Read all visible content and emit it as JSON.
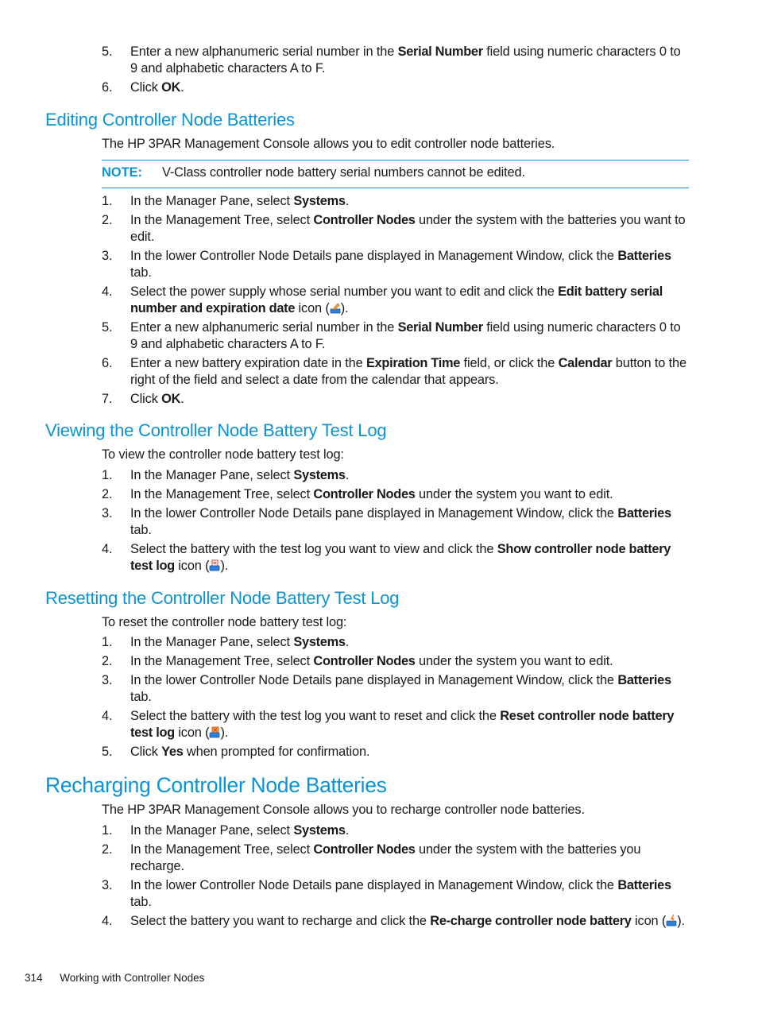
{
  "top_steps": [
    {
      "num": "5.",
      "parts": [
        {
          "t": "Enter a new alphanumeric serial number in the "
        },
        {
          "t": "Serial Number",
          "b": true
        },
        {
          "t": " field using numeric characters 0 to 9 and alphabetic characters A to F."
        }
      ]
    },
    {
      "num": "6.",
      "parts": [
        {
          "t": "Click "
        },
        {
          "t": "OK",
          "b": true
        },
        {
          "t": "."
        }
      ]
    }
  ],
  "sections": {
    "editing": {
      "title": "Editing Controller Node Batteries",
      "intro": "The HP 3PAR Management Console allows you to edit controller node batteries.",
      "note_label": "NOTE:",
      "note_text": "V-Class controller node battery serial numbers cannot be edited.",
      "icon": "edit-battery-serial-icon",
      "steps": [
        {
          "num": "1.",
          "parts": [
            {
              "t": "In the Manager Pane, select "
            },
            {
              "t": "Systems",
              "b": true
            },
            {
              "t": "."
            }
          ]
        },
        {
          "num": "2.",
          "parts": [
            {
              "t": "In the Management Tree, select "
            },
            {
              "t": "Controller Nodes",
              "b": true
            },
            {
              "t": " under the system with the batteries you want to edit."
            }
          ]
        },
        {
          "num": "3.",
          "parts": [
            {
              "t": "In the lower Controller Node Details pane displayed in Management Window, click the "
            },
            {
              "t": "Batteries",
              "b": true
            },
            {
              "t": " tab."
            }
          ]
        },
        {
          "num": "4.",
          "parts": [
            {
              "t": "Select the power supply whose serial number you want to edit and click the "
            },
            {
              "t": "Edit battery serial number and expiration date",
              "b": true
            },
            {
              "t": " icon ("
            },
            {
              "icon": "edit"
            },
            {
              "t": ")."
            }
          ]
        },
        {
          "num": "5.",
          "parts": [
            {
              "t": "Enter a new alphanumeric serial number in the "
            },
            {
              "t": "Serial Number",
              "b": true
            },
            {
              "t": " field using numeric characters 0 to 9 and alphabetic characters A to F."
            }
          ]
        },
        {
          "num": "6.",
          "parts": [
            {
              "t": "Enter a new battery expiration date in the "
            },
            {
              "t": "Expiration Time",
              "b": true
            },
            {
              "t": " field, or click the "
            },
            {
              "t": "Calendar",
              "b": true
            },
            {
              "t": " button to the right of the field and select a date from the calendar that appears."
            }
          ]
        },
        {
          "num": "7.",
          "parts": [
            {
              "t": "Click "
            },
            {
              "t": "OK",
              "b": true
            },
            {
              "t": "."
            }
          ]
        }
      ]
    },
    "viewing": {
      "title": "Viewing the Controller Node Battery Test Log",
      "intro": "To view the controller node battery test log:",
      "steps": [
        {
          "num": "1.",
          "parts": [
            {
              "t": "In the Manager Pane, select "
            },
            {
              "t": "Systems",
              "b": true
            },
            {
              "t": "."
            }
          ]
        },
        {
          "num": "2.",
          "parts": [
            {
              "t": "In the Management Tree, select "
            },
            {
              "t": "Controller Nodes",
              "b": true
            },
            {
              "t": " under the system you want to edit."
            }
          ]
        },
        {
          "num": "3.",
          "parts": [
            {
              "t": "In the lower Controller Node Details pane displayed in Management Window, click the "
            },
            {
              "t": "Batteries",
              "b": true
            },
            {
              "t": " tab."
            }
          ]
        },
        {
          "num": "4.",
          "parts": [
            {
              "t": "Select the battery with the test log you want to view and click the "
            },
            {
              "t": "Show controller node battery test log",
              "b": true
            },
            {
              "t": " icon ("
            },
            {
              "icon": "show"
            },
            {
              "t": ")."
            }
          ]
        }
      ]
    },
    "resetting": {
      "title": "Resetting the Controller Node Battery Test Log",
      "intro": "To reset the controller node battery test log:",
      "steps": [
        {
          "num": "1.",
          "parts": [
            {
              "t": "In the Manager Pane, select "
            },
            {
              "t": "Systems",
              "b": true
            },
            {
              "t": "."
            }
          ]
        },
        {
          "num": "2.",
          "parts": [
            {
              "t": "In the Management Tree, select "
            },
            {
              "t": "Controller Nodes",
              "b": true
            },
            {
              "t": " under the system you want to edit."
            }
          ]
        },
        {
          "num": "3.",
          "parts": [
            {
              "t": "In the lower Controller Node Details pane displayed in Management Window, click the "
            },
            {
              "t": "Batteries",
              "b": true
            },
            {
              "t": " tab."
            }
          ]
        },
        {
          "num": "4.",
          "parts": [
            {
              "t": "Select the battery with the test log you want to reset and click the "
            },
            {
              "t": "Reset controller node battery test log",
              "b": true
            },
            {
              "t": " icon ("
            },
            {
              "icon": "reset"
            },
            {
              "t": ")."
            }
          ]
        },
        {
          "num": "5.",
          "parts": [
            {
              "t": "Click "
            },
            {
              "t": "Yes",
              "b": true
            },
            {
              "t": " when prompted for confirmation."
            }
          ]
        }
      ]
    },
    "recharging": {
      "title": "Recharging Controller Node Batteries",
      "intro": "The HP 3PAR Management Console allows you to recharge controller node batteries.",
      "steps": [
        {
          "num": "1.",
          "parts": [
            {
              "t": "In the Manager Pane, select "
            },
            {
              "t": "Systems",
              "b": true
            },
            {
              "t": "."
            }
          ]
        },
        {
          "num": "2.",
          "parts": [
            {
              "t": "In the Management Tree, select "
            },
            {
              "t": "Controller Nodes",
              "b": true
            },
            {
              "t": " under the system with the batteries you recharge."
            }
          ]
        },
        {
          "num": "3.",
          "parts": [
            {
              "t": "In the lower Controller Node Details pane displayed in Management Window, click the "
            },
            {
              "t": "Batteries",
              "b": true
            },
            {
              "t": " tab."
            }
          ]
        },
        {
          "num": "4.",
          "parts": [
            {
              "t": "Select the battery you want to recharge and click the "
            },
            {
              "t": "Re-charge controller node battery",
              "b": true
            },
            {
              "t": "  icon ("
            },
            {
              "icon": "recharge"
            },
            {
              "t": ")."
            }
          ]
        }
      ]
    }
  },
  "footer": {
    "page_number": "314",
    "chapter": "Working with Controller Nodes"
  },
  "colors": {
    "heading": "#0a94d6",
    "text": "#1a1a1a"
  }
}
